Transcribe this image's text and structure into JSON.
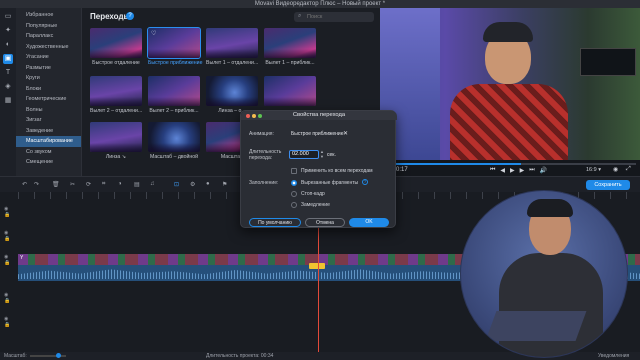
{
  "window": {
    "title": "Movavi Видеоредактор Плюс – Новый проект *"
  },
  "rail": {
    "icons": [
      "file-icon",
      "magic-icon",
      "filter-icon",
      "transition-icon",
      "text-icon",
      "sticker-icon",
      "grid-icon"
    ]
  },
  "categories": [
    {
      "label": "Избранное"
    },
    {
      "label": "Популярные"
    },
    {
      "label": "Параллакс"
    },
    {
      "label": "Художественные"
    },
    {
      "label": "Угасание"
    },
    {
      "label": "Размытие"
    },
    {
      "label": "Круги"
    },
    {
      "label": "Блоки"
    },
    {
      "label": "Геометрические"
    },
    {
      "label": "Волны"
    },
    {
      "label": "Зигзаг"
    },
    {
      "label": "Заведение"
    },
    {
      "label": "Масштабирование"
    },
    {
      "label": "Со звуком"
    },
    {
      "label": "Смещение"
    }
  ],
  "panel": {
    "title": "Переходы",
    "search_placeholder": "Поиск",
    "tiles": [
      {
        "label": "Быстрое отдаление"
      },
      {
        "label": "Быстрое приближение"
      },
      {
        "label": "Вылет 1 – отдалени..."
      },
      {
        "label": "Вылет 1 – приблик..."
      },
      {
        "label": "Вылет 2 – отдалени..."
      },
      {
        "label": "Вылет 2 – приблик..."
      },
      {
        "label": "Линза – о..."
      },
      {
        "label": ""
      },
      {
        "label": ""
      },
      {
        "label": "Линза ↘"
      },
      {
        "label": "Масштаб – двойной"
      },
      {
        "label": "Масштаб"
      }
    ]
  },
  "player": {
    "time": "0:17",
    "ratio": "16:9 ▾",
    "progress": 0.52
  },
  "toolbar": {
    "export_label": "Сохранить"
  },
  "timeline": {
    "clip_label": "Y"
  },
  "statusbar": {
    "zoom_label": "Масштаб:",
    "duration": "Длительность проекта: 00:34",
    "notifications": "Уведомления"
  },
  "dialog": {
    "title": "Свойства перехода",
    "animation_label": "Анимация:",
    "animation_value": "Быстрое приближение",
    "duration_label": "Длительность перехода:",
    "duration_value": "02.000",
    "duration_unit": "сек.",
    "apply_all_label": "Применить ко всем переходам",
    "fill_label": "Заполнение:",
    "fill_options": [
      "Вырезанные фрагменты",
      "Стоп-кадр",
      "Замедление"
    ],
    "btn_default": "По умолчанию",
    "btn_cancel": "Отмена",
    "btn_ok": "OK"
  }
}
